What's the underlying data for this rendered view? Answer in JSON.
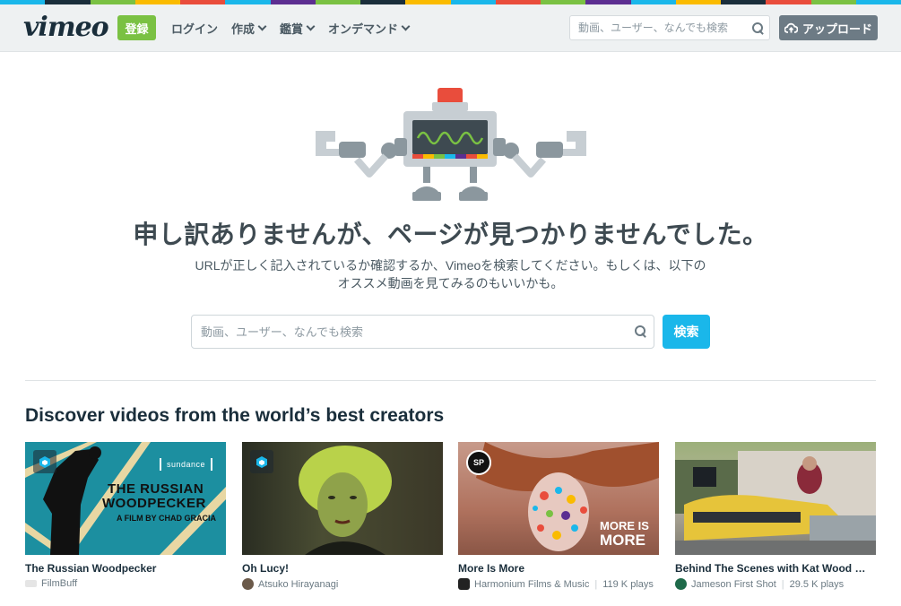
{
  "header": {
    "logo": "vimeo",
    "register_label": "登録",
    "nav": [
      {
        "label": "ログイン",
        "dropdown": false
      },
      {
        "label": "作成",
        "dropdown": true
      },
      {
        "label": "鑑賞",
        "dropdown": true
      },
      {
        "label": "オンデマンド",
        "dropdown": true
      }
    ],
    "search_placeholder": "動画、ユーザー、なんでも検索",
    "upload_label": "アップロード"
  },
  "error": {
    "title": "申し訳ありませんが、ページが見つかりませんでした。",
    "subtitle_line1": "URLが正しく記入されているか確認するか、Vimeoを検索してください。もしくは、以下の",
    "subtitle_line2": "オススメ動画を見てみるのもいいかも。",
    "search_placeholder": "動画、ユーザー、なんでも検索",
    "search_button": "検索"
  },
  "discover": {
    "heading": "Discover videos from the world’s best creators",
    "videos": [
      {
        "title": "The Russian Woodpecker",
        "creator": "FilmBuff",
        "plays": "",
        "thumb_text_1": "THE RUSSIAN",
        "thumb_text_2": "WOODPECKER",
        "thumb_text_3": "A FILM BY CHAD GRACIA",
        "thumb_logo": "sundance"
      },
      {
        "title": "Oh Lucy!",
        "creator": "Atsuko Hirayanagi",
        "plays": ""
      },
      {
        "title": "More Is More",
        "creator": "Harmonium Films & Music",
        "plays": "119 K plays",
        "thumb_text_1": "MORE IS",
        "thumb_text_2": "MORE",
        "badge_text": "SP"
      },
      {
        "title": "Behind The Scenes with Kat Wood @ J...",
        "creator": "Jameson First Shot",
        "plays": "29.5 K plays"
      }
    ]
  },
  "colors": {
    "accent_green": "#7ac143",
    "accent_blue": "#1ab7ea",
    "text_dark": "#1a2e3b"
  }
}
